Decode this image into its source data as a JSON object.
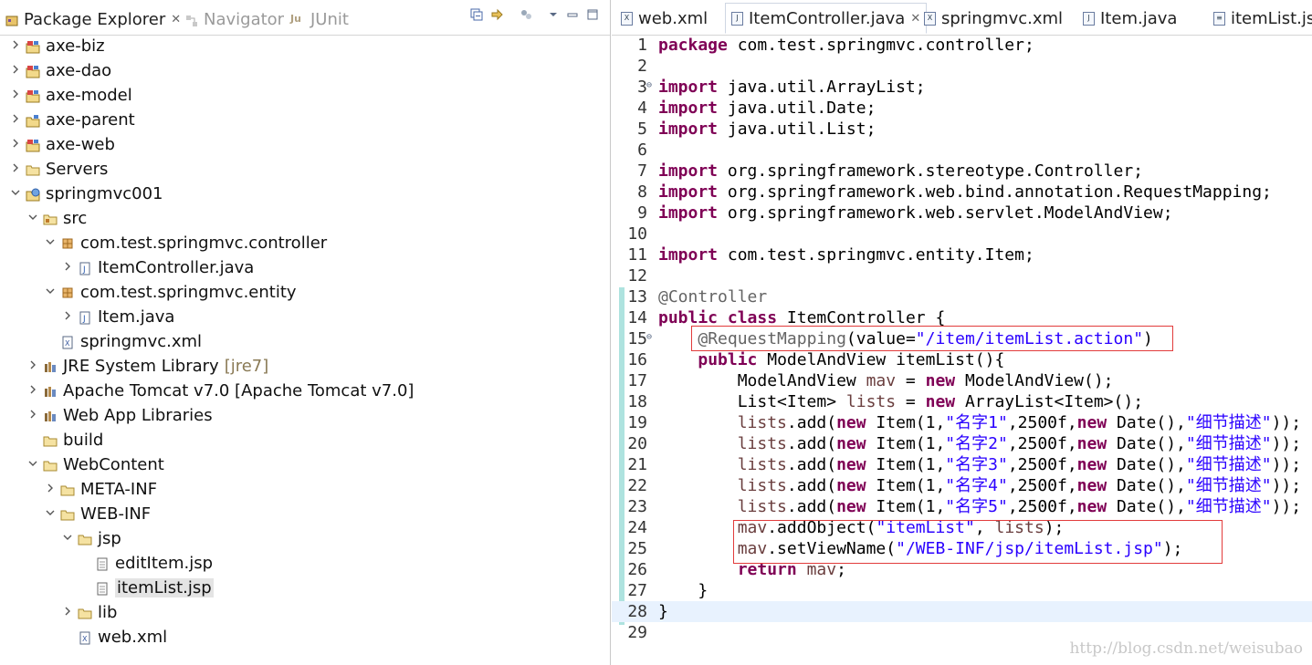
{
  "left_tabs": [
    {
      "label": "Package Explorer",
      "active": true
    },
    {
      "label": "Navigator",
      "active": false
    },
    {
      "label": "JUnit",
      "active": false
    }
  ],
  "tree": [
    {
      "label": "axe-biz",
      "indent": 0,
      "arrow": "›",
      "icon": "project-icon"
    },
    {
      "label": "axe-dao",
      "indent": 0,
      "arrow": "›",
      "icon": "project-icon"
    },
    {
      "label": "axe-model",
      "indent": 0,
      "arrow": "›",
      "icon": "project-icon"
    },
    {
      "label": "axe-parent",
      "indent": 0,
      "arrow": "›",
      "icon": "folder-project-icon"
    },
    {
      "label": "axe-web",
      "indent": 0,
      "arrow": "›",
      "icon": "project-icon"
    },
    {
      "label": "Servers",
      "indent": 0,
      "arrow": "›",
      "icon": "folder-icon"
    },
    {
      "label": "springmvc001",
      "indent": 0,
      "arrow": "⌄",
      "icon": "web-project-icon"
    },
    {
      "label": "src",
      "indent": 1,
      "arrow": "⌄",
      "icon": "source-folder-icon"
    },
    {
      "label": "com.test.springmvc.controller",
      "indent": 2,
      "arrow": "⌄",
      "icon": "package-icon"
    },
    {
      "label": "ItemController.java",
      "indent": 3,
      "arrow": "›",
      "icon": "java-file-icon"
    },
    {
      "label": "com.test.springmvc.entity",
      "indent": 2,
      "arrow": "⌄",
      "icon": "package-icon"
    },
    {
      "label": "Item.java",
      "indent": 3,
      "arrow": "›",
      "icon": "java-file-icon"
    },
    {
      "label": "springmvc.xml",
      "indent": 2,
      "arrow": "",
      "icon": "xml-file-icon"
    },
    {
      "label": "JRE System Library",
      "decoration": "[jre7]",
      "indent": 1,
      "arrow": "›",
      "icon": "library-icon"
    },
    {
      "label": "Apache Tomcat v7.0 [Apache Tomcat v7.0]",
      "indent": 1,
      "arrow": "›",
      "icon": "library-icon"
    },
    {
      "label": "Web App Libraries",
      "indent": 1,
      "arrow": "›",
      "icon": "library-icon"
    },
    {
      "label": "build",
      "indent": 1,
      "arrow": "",
      "icon": "folder-icon"
    },
    {
      "label": "WebContent",
      "indent": 1,
      "arrow": "⌄",
      "icon": "folder-icon"
    },
    {
      "label": "META-INF",
      "indent": 2,
      "arrow": "›",
      "icon": "folder-icon"
    },
    {
      "label": "WEB-INF",
      "indent": 2,
      "arrow": "⌄",
      "icon": "folder-icon"
    },
    {
      "label": "jsp",
      "indent": 3,
      "arrow": "⌄",
      "icon": "folder-icon"
    },
    {
      "label": "editItem.jsp",
      "indent": 4,
      "arrow": "",
      "icon": "jsp-file-icon"
    },
    {
      "label": "itemList.jsp",
      "indent": 4,
      "arrow": "",
      "icon": "jsp-file-icon",
      "selected": true
    },
    {
      "label": "lib",
      "indent": 3,
      "arrow": "›",
      "icon": "folder-icon"
    },
    {
      "label": "web.xml",
      "indent": 3,
      "arrow": "",
      "icon": "xml-file-icon"
    }
  ],
  "editor_tabs": [
    {
      "label": "web.xml",
      "icon": "xml-file-icon"
    },
    {
      "label": "ItemController.java",
      "icon": "java-file-icon",
      "active": true
    },
    {
      "label": "springmvc.xml",
      "icon": "xml-file-icon"
    },
    {
      "label": "Item.java",
      "icon": "java-file-icon"
    },
    {
      "label": "itemList.jsp",
      "icon": "jsp-file-icon"
    }
  ],
  "code": [
    {
      "n": "1",
      "text": "package com.test.springmvc.controller;"
    },
    {
      "n": "2",
      "text": ""
    },
    {
      "n": "3",
      "text": "import java.util.ArrayList;",
      "fold": true
    },
    {
      "n": "4",
      "text": "import java.util.Date;"
    },
    {
      "n": "5",
      "text": "import java.util.List;"
    },
    {
      "n": "6",
      "text": ""
    },
    {
      "n": "7",
      "text": "import org.springframework.stereotype.Controller;"
    },
    {
      "n": "8",
      "text": "import org.springframework.web.bind.annotation.RequestMapping;"
    },
    {
      "n": "9",
      "text": "import org.springframework.web.servlet.ModelAndView;"
    },
    {
      "n": "10",
      "text": ""
    },
    {
      "n": "11",
      "text": "import com.test.springmvc.entity.Item;"
    },
    {
      "n": "12",
      "text": ""
    },
    {
      "n": "13",
      "text": "@Controller"
    },
    {
      "n": "14",
      "text": "public class ItemController {"
    },
    {
      "n": "15",
      "text": "    @RequestMapping(value=\"/item/itemList.action\")",
      "fold": true
    },
    {
      "n": "16",
      "text": "    public ModelAndView itemList(){"
    },
    {
      "n": "17",
      "text": "        ModelAndView mav = new ModelAndView();"
    },
    {
      "n": "18",
      "text": "        List<Item> lists = new ArrayList<Item>();"
    },
    {
      "n": "19",
      "text": "        lists.add(new Item(1,\"名字1\",2500f,new Date(),\"细节描述\"));"
    },
    {
      "n": "20",
      "text": "        lists.add(new Item(1,\"名字2\",2500f,new Date(),\"细节描述\"));"
    },
    {
      "n": "21",
      "text": "        lists.add(new Item(1,\"名字3\",2500f,new Date(),\"细节描述\"));"
    },
    {
      "n": "22",
      "text": "        lists.add(new Item(1,\"名字4\",2500f,new Date(),\"细节描述\"));"
    },
    {
      "n": "23",
      "text": "        lists.add(new Item(1,\"名字5\",2500f,new Date(),\"细节描述\"));"
    },
    {
      "n": "24",
      "text": "        mav.addObject(\"itemList\", lists);"
    },
    {
      "n": "25",
      "text": "        mav.setViewName(\"/WEB-INF/jsp/itemList.jsp\");"
    },
    {
      "n": "26",
      "text": "        return mav;"
    },
    {
      "n": "27",
      "text": "    }"
    },
    {
      "n": "28",
      "text": "}",
      "current": true
    },
    {
      "n": "29",
      "text": ""
    }
  ],
  "watermark": "http://blog.csdn.net/weisubao",
  "colors": {
    "keyword": "#7f0055",
    "string": "#2a00ff",
    "annotation": "#646464",
    "highlight_box": "#e23b3b"
  }
}
